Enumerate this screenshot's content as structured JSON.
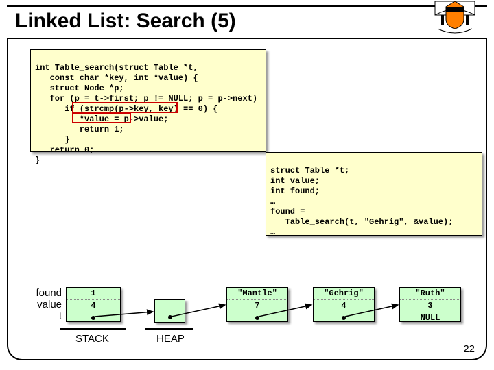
{
  "title": "Linked List: Search (5)",
  "code_left": {
    "l0": "int Table_search(struct Table *t,",
    "l1": "   const char *key, int *value) {",
    "l2": "   struct Node *p;",
    "l3": "   for (p = t->first; p != NULL; p = p->next)",
    "l4": "      if (strcmp(p->key, key) == 0) {",
    "l5": "         *value = p->value;",
    "l6": "         return 1;",
    "l7": "      }",
    "l8": "   return 0;",
    "l9": "}"
  },
  "code_right": {
    "l0": "struct Table *t;",
    "l1": "int value;",
    "l2": "int found;",
    "l3": "…",
    "l4": "found =",
    "l5": "   Table_search(t, \"Gehrig\", &value);",
    "l6": "…"
  },
  "stack": {
    "labels": {
      "found": "found",
      "value": "value",
      "t": "t"
    },
    "found": "1",
    "value": "4"
  },
  "nodes": {
    "n1": {
      "key": "\"Mantle\"",
      "val": "7"
    },
    "n2": {
      "key": "\"Gehrig\"",
      "val": "4"
    },
    "n3": {
      "key": "\"Ruth\"",
      "val": "3",
      "next": "NULL"
    }
  },
  "labels": {
    "stack": "STACK",
    "heap": "HEAP"
  },
  "page": "22"
}
